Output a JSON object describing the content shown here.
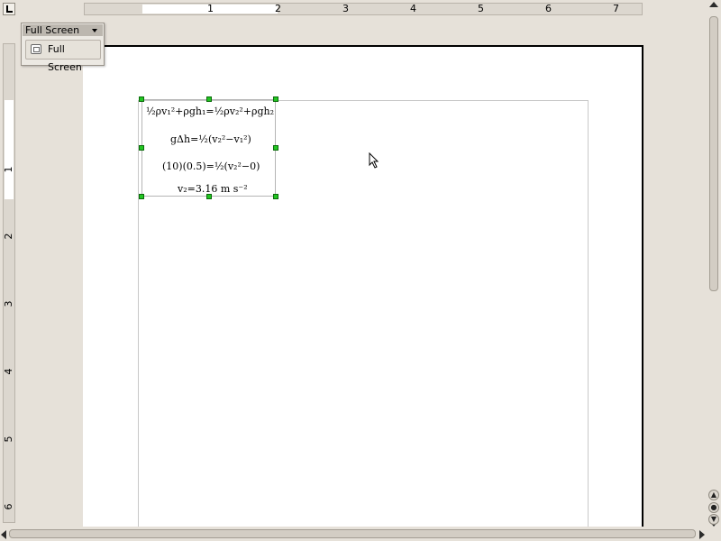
{
  "toolbar": {
    "title": "Full Screen",
    "button_label": "Full Screen",
    "button_icon": "fullscreen-icon"
  },
  "hruler": {
    "labels": [
      "1",
      "2",
      "3",
      "4",
      "5",
      "6",
      "7"
    ]
  },
  "vruler": {
    "labels": [
      "1",
      "2",
      "3",
      "4",
      "5",
      "6"
    ]
  },
  "formula": {
    "line1": "½ρv₁²+ρgh₁=½ρv₂²+ρgh₂",
    "line2": "gΔh=½(v₂²−v₁²)",
    "line3": "(10)(0.5)=½(v₂²−0)",
    "line4": "v₂=3.16 m s⁻²"
  },
  "colors": {
    "selection_handle": "#22c522",
    "background": "#e6e1d9"
  }
}
